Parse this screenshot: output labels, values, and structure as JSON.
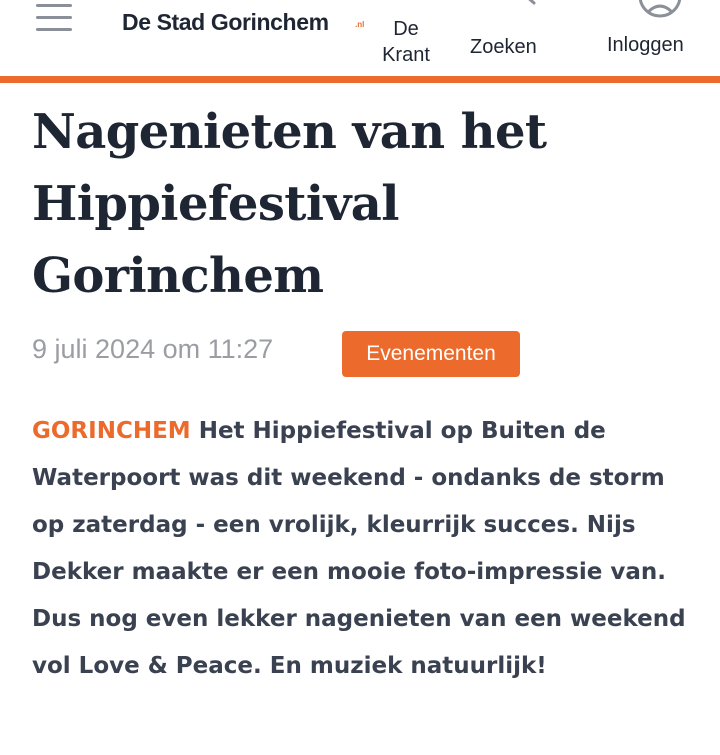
{
  "header": {
    "logo_text": "De Stad Gorinchem",
    "logo_tld": ".nl",
    "nav": {
      "krant": "De Krant",
      "zoeken": "Zoeken",
      "inloggen": "Inloggen"
    }
  },
  "article": {
    "title": "Nagenieten van het Hippiefestival Gorinchem",
    "date": "9 juli 2024 om 11:27",
    "category": "Evenementen",
    "dateline": "GORINCHEM",
    "lead": "Het Hippiefestival op Buiten de Waterpoort was dit weekend - ondanks de storm op zaterdag - een vrolijk, kleurrijk succes. Nijs Dekker maakte er een mooie foto-impressie van. Dus nog even lekker nagenieten van een weekend vol Love & Peace. En muziek natuurlijk!"
  },
  "colors": {
    "accent": "#ec6a2c",
    "text": "#1e2533",
    "muted": "#9a9da3"
  },
  "icons": [
    "menu-icon",
    "search-icon",
    "user-icon"
  ]
}
